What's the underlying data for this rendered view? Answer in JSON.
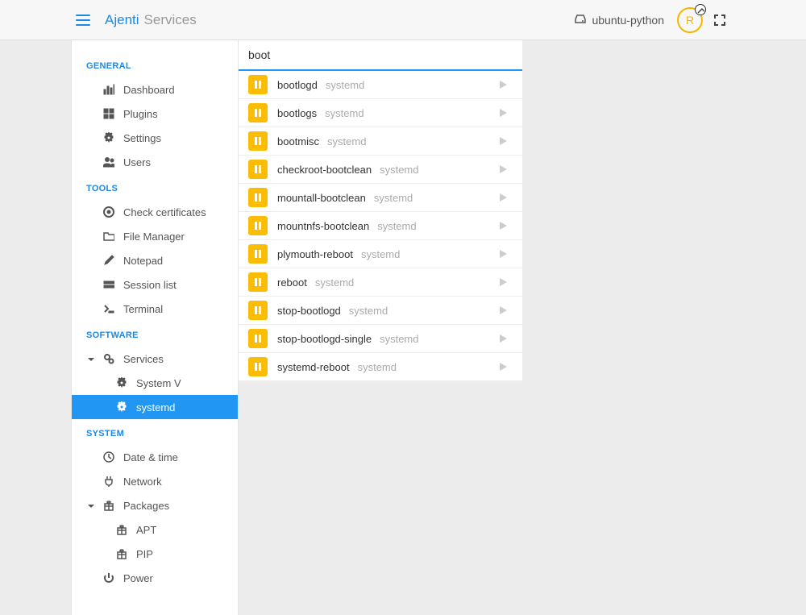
{
  "header": {
    "brand": "Ajenti",
    "page_title": "Services",
    "host": "ubuntu-python",
    "avatar_letter": "R"
  },
  "sidebar": {
    "sections": {
      "general": {
        "title": "GENERAL",
        "items": [
          {
            "label": "Dashboard",
            "icon": "chart"
          },
          {
            "label": "Plugins",
            "icon": "grid"
          },
          {
            "label": "Settings",
            "icon": "gear"
          },
          {
            "label": "Users",
            "icon": "users"
          }
        ]
      },
      "tools": {
        "title": "TOOLS",
        "items": [
          {
            "label": "Check certificates",
            "icon": "certificate"
          },
          {
            "label": "File Manager",
            "icon": "folder"
          },
          {
            "label": "Notepad",
            "icon": "pencil"
          },
          {
            "label": "Session list",
            "icon": "sessions"
          },
          {
            "label": "Terminal",
            "icon": "terminal"
          }
        ]
      },
      "software": {
        "title": "SOFTWARE",
        "services": {
          "label": "Services"
        },
        "service_children": [
          {
            "label": "System V"
          },
          {
            "label": "systemd",
            "active": true
          }
        ]
      },
      "system": {
        "title": "SYSTEM",
        "items": [
          {
            "label": "Date & time",
            "icon": "clock"
          },
          {
            "label": "Network",
            "icon": "plug"
          },
          {
            "label": "Packages",
            "icon": "gift",
            "expandable": true
          },
          {
            "label": "Power",
            "icon": "power"
          }
        ],
        "package_children": [
          {
            "label": "APT"
          },
          {
            "label": "PIP"
          }
        ]
      }
    }
  },
  "main": {
    "search_value": "boot",
    "services": [
      {
        "name": "bootlogd",
        "manager": "systemd"
      },
      {
        "name": "bootlogs",
        "manager": "systemd"
      },
      {
        "name": "bootmisc",
        "manager": "systemd"
      },
      {
        "name": "checkroot-bootclean",
        "manager": "systemd"
      },
      {
        "name": "mountall-bootclean",
        "manager": "systemd"
      },
      {
        "name": "mountnfs-bootclean",
        "manager": "systemd"
      },
      {
        "name": "plymouth-reboot",
        "manager": "systemd"
      },
      {
        "name": "reboot",
        "manager": "systemd"
      },
      {
        "name": "stop-bootlogd",
        "manager": "systemd"
      },
      {
        "name": "stop-bootlogd-single",
        "manager": "systemd"
      },
      {
        "name": "systemd-reboot",
        "manager": "systemd"
      }
    ]
  }
}
